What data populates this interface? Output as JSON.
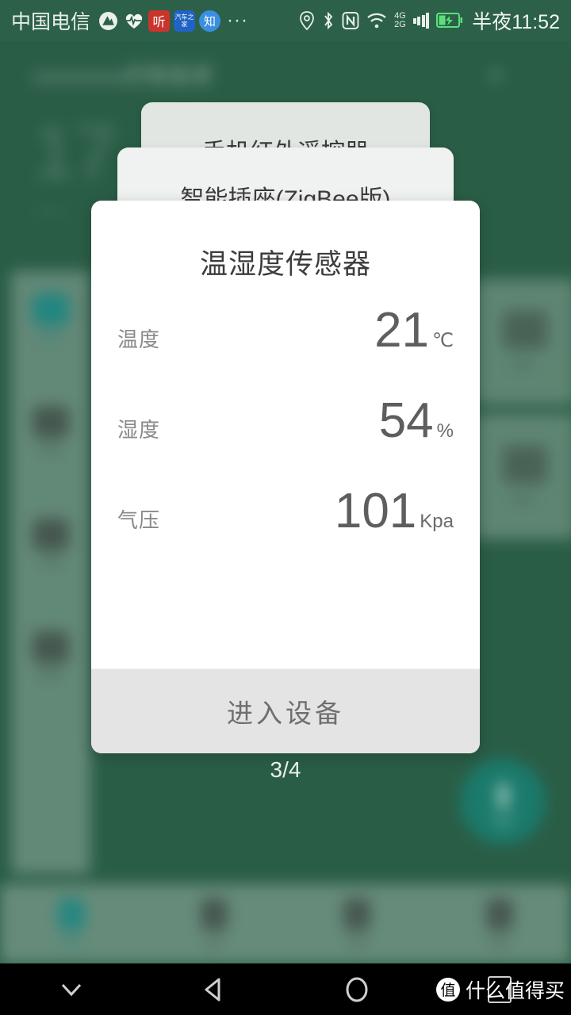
{
  "statusbar": {
    "carrier": "中国电信",
    "notif_icons": [
      {
        "name": "peak-icon",
        "glyph": "▲"
      },
      {
        "name": "heartbeat-icon",
        "glyph": "♥"
      },
      {
        "name": "ting-app-icon",
        "glyph": "听"
      },
      {
        "name": "autohome-app-icon",
        "glyph": "汽车之家"
      },
      {
        "name": "zhihu-app-icon",
        "glyph": "知"
      }
    ],
    "overflow": "···",
    "system_icons": [
      "location-icon",
      "bluetooth-icon",
      "nfc-icon",
      "wifi-icon",
      "signal-4g-icon",
      "signal-2g-icon",
      "battery-charging-icon"
    ],
    "signal_4g_label": "4G",
    "signal_2g_label": "2G",
    "time": "半夜11:52"
  },
  "background": {
    "header_title": "xxxxxxxx的智能家",
    "add_icon": "+",
    "big_number": "17",
    "big_number_sub": "•••••",
    "sidebar_items": [
      {
        "label": "客厅",
        "active": true
      },
      {
        "label": "卧室",
        "active": false
      },
      {
        "label": "书房",
        "active": false
      },
      {
        "label": "厨房",
        "active": false
      }
    ],
    "tiles": [
      {
        "label": "设备一"
      },
      {
        "label": "设备二"
      }
    ],
    "fab": "voice-mic-icon",
    "bottom_nav": [
      {
        "label": "家居",
        "active": true
      },
      {
        "label": "发现",
        "active": false
      },
      {
        "label": "商城",
        "active": false
      },
      {
        "label": "我的",
        "active": false
      }
    ]
  },
  "stack_cards": [
    {
      "title": "手机红外遥控器"
    },
    {
      "title": "智能插座(ZigBee版)"
    }
  ],
  "dialog": {
    "title": "温湿度传感器",
    "rows": [
      {
        "label": "温度",
        "value": "21",
        "unit": "℃"
      },
      {
        "label": "湿度",
        "value": "54",
        "unit": "%"
      },
      {
        "label": "气压",
        "value": "101",
        "unit": "Kpa"
      }
    ],
    "button_label": "进入设备"
  },
  "page_indicator": "3/4",
  "navbar": {
    "buttons": [
      "chevron-down-icon",
      "back-icon",
      "home-icon",
      "recents-icon"
    ],
    "watermark_badge": "值",
    "watermark_text": "什么值得买"
  },
  "colors": {
    "brand_green": "#2c6049",
    "accent_teal": "#1b7f70",
    "dialog_bg": "#ffffff",
    "button_bg": "#e4e4e4"
  }
}
